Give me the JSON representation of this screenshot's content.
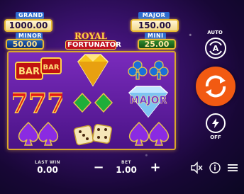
{
  "jackpots": {
    "grand": {
      "label": "GRAND",
      "value": "1000.00"
    },
    "minor": {
      "label": "MINOR",
      "value": "50.00"
    },
    "major": {
      "label": "MAJOR",
      "value": "150.00"
    },
    "mini": {
      "label": "MINI",
      "value": "25.00"
    }
  },
  "logo": {
    "line1": "ROYAL",
    "line2": "FORTUNATOR"
  },
  "reels": [
    [
      "bar-symbol",
      "seven-symbol",
      "spades-symbol"
    ],
    [
      "yellow-diamond-symbol",
      "green-diamonds-symbol",
      "dice-symbol"
    ],
    [
      "clubs-symbol",
      "major-diamond-symbol",
      "spades-symbol"
    ]
  ],
  "symbols": {
    "bar_text": "BAR",
    "seven_text": "777",
    "major_text": "MAJOR"
  },
  "side": {
    "auto_label": "AUTO",
    "auto_letter": "A",
    "off_label": "OFF"
  },
  "bottom": {
    "last_win_label": "LAST WIN",
    "last_win_value": "0.00",
    "bet_label": "BET",
    "bet_value": "1.00",
    "minus": "−",
    "plus": "+"
  },
  "colors": {
    "spin": "#f25a12",
    "gold": "#e8b830",
    "reel_bg": "#5a1a9a"
  },
  "icons": [
    "auto-spin-icon",
    "spin-icon",
    "turbo-off-icon",
    "sound-muted-icon",
    "info-icon",
    "menu-icon"
  ]
}
